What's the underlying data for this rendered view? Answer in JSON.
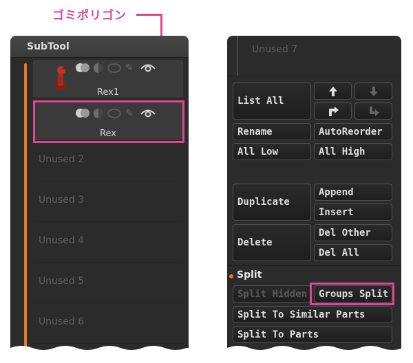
{
  "callout": {
    "label": "ゴミポリゴン",
    "color": "#e0468e"
  },
  "accent": "#e37a1e",
  "left_panel": {
    "title": "SubTool",
    "slots": [
      {
        "name": "Rex1",
        "active": true
      },
      {
        "name": "Rex",
        "active": true
      },
      {
        "name": "Unused 2"
      },
      {
        "name": "Unused 3"
      },
      {
        "name": "Unused 4"
      },
      {
        "name": "Unused 5"
      },
      {
        "name": "Unused 6"
      }
    ]
  },
  "right_panel": {
    "unused_label": "Unused 7",
    "buttons": {
      "list_all": "List All",
      "rename": "Rename",
      "auto_reorder": "AutoReorder",
      "all_low": "All Low",
      "all_high": "All High",
      "duplicate": "Duplicate",
      "append": "Append",
      "insert": "Insert",
      "delete": "Delete",
      "del_other": "Del Other",
      "del_all": "Del All",
      "split_hidden": "Split Hidden",
      "groups_split": "Groups Split",
      "split_to_similar": "Split To Similar Parts",
      "split_to_parts": "Split To Parts"
    },
    "split_section": "Split"
  }
}
